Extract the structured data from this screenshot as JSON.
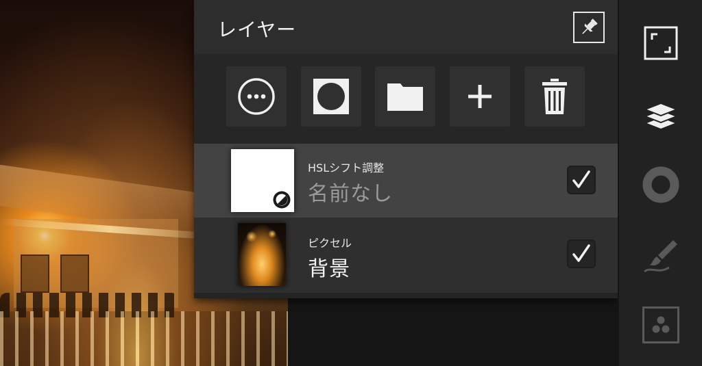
{
  "layers_panel": {
    "title": "レイヤー",
    "pin_icon": "pushpin-icon",
    "toolbar": [
      {
        "name": "more-options-button",
        "icon": "ellipsis-circle-icon"
      },
      {
        "name": "add-mask-button",
        "icon": "mask-circle-icon"
      },
      {
        "name": "new-folder-button",
        "icon": "folder-icon"
      },
      {
        "name": "add-layer-button",
        "icon": "plus-icon"
      },
      {
        "name": "delete-layer-button",
        "icon": "trash-icon"
      }
    ],
    "layers": [
      {
        "type": "HSLシフト調整",
        "name": "名前なし",
        "visible": true,
        "selected": true
      },
      {
        "type": "ピクセル",
        "name": "背景",
        "visible": true,
        "selected": false
      }
    ]
  },
  "sidebar": {
    "items": [
      {
        "name": "fullscreen-button",
        "icon": "fullscreen-corners-icon"
      },
      {
        "name": "layers-button",
        "icon": "layers-stack-icon",
        "active": true
      },
      {
        "name": "adjustments-button",
        "icon": "ring-icon"
      },
      {
        "name": "brush-button",
        "icon": "brush-icon"
      },
      {
        "name": "effects-button",
        "icon": "dots-cluster-icon"
      }
    ]
  },
  "colors": {
    "panel_bg": "#2b2b2b",
    "selected_row": "#434343",
    "sidebar_bg": "#222222",
    "icon_white": "#f0f0f0",
    "icon_dim": "#5a5a5a"
  }
}
